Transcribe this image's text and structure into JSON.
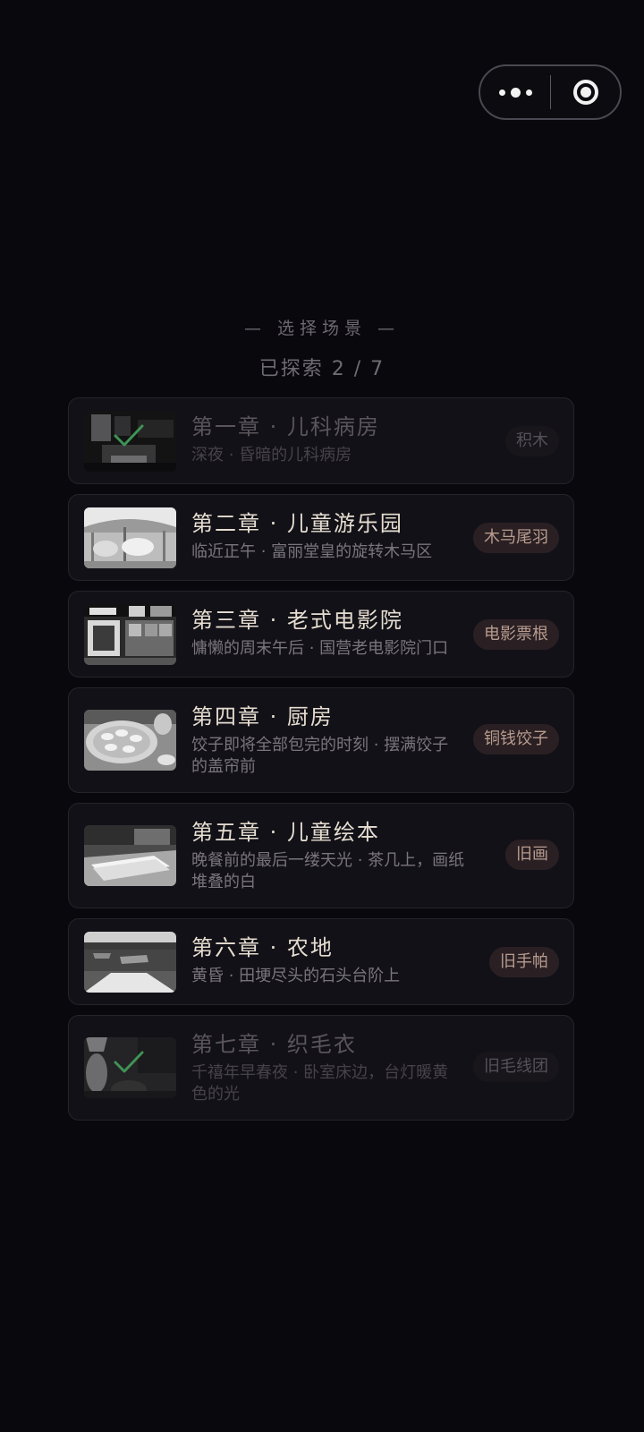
{
  "header": {
    "title": "— 选择场景 —",
    "progress": "已探索 2 / 7"
  },
  "capsule": {
    "more_icon": "more-dots-icon",
    "close_icon": "target-close-icon"
  },
  "chapters": [
    {
      "title": "第一章 · 儿科病房",
      "subtitle": "深夜 · 昏暗的儿科病房",
      "tag": "积木",
      "explored": true
    },
    {
      "title": "第二章 · 儿童游乐园",
      "subtitle": "临近正午 · 富丽堂皇的旋转木马区",
      "tag": "木马尾羽",
      "explored": false
    },
    {
      "title": "第三章 · 老式电影院",
      "subtitle": "慵懒的周末午后 · 国营老电影院门口",
      "tag": "电影票根",
      "explored": false
    },
    {
      "title": "第四章 · 厨房",
      "subtitle": "饺子即将全部包完的时刻 · 摆满饺子的盖帘前",
      "tag": "铜钱饺子",
      "explored": false
    },
    {
      "title": "第五章 · 儿童绘本",
      "subtitle": "晚餐前的最后一缕天光 · 茶几上，画纸堆叠的白",
      "tag": "旧画",
      "explored": false
    },
    {
      "title": "第六章 · 农地",
      "subtitle": "黄昏 · 田埂尽头的石头台阶上",
      "tag": "旧手帕",
      "explored": false
    },
    {
      "title": "第七章 · 织毛衣",
      "subtitle": "千禧年早春夜 · 卧室床边，台灯暖黄色的光",
      "tag": "旧毛线团",
      "explored": true
    }
  ]
}
